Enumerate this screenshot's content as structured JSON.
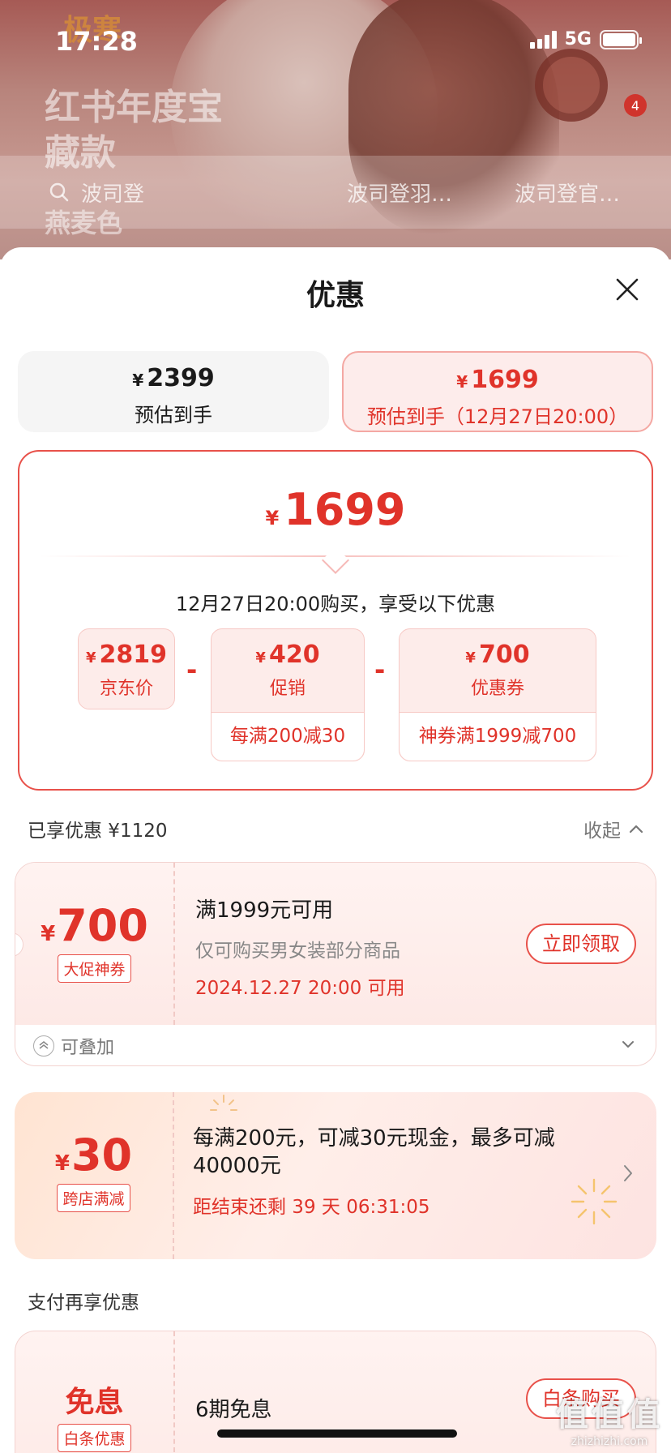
{
  "status_bar": {
    "time": "17:28",
    "network": "5G"
  },
  "background": {
    "promo_tag": "极寒",
    "promo_title": "红书年度宝藏款",
    "promo_sub": "燕麦色",
    "badge_count": "4",
    "search": [
      "波司登",
      "波司登羽…",
      "波司登官…"
    ]
  },
  "sheet": {
    "title": "优惠",
    "price_options": [
      {
        "yen": "¥",
        "price": "2399",
        "label": "预估到手"
      },
      {
        "yen": "¥",
        "price": "1699",
        "label": "预估到手（12月27日20:00）"
      }
    ],
    "calc": {
      "yen": "¥",
      "total": "1699",
      "note": "12月27日20:00购买，享受以下优惠",
      "items": [
        {
          "yen": "¥",
          "value": "2819",
          "name": "京东价",
          "extra": ""
        },
        {
          "yen": "¥",
          "value": "420",
          "name": "促销",
          "extra": "每满200减30"
        },
        {
          "yen": "¥",
          "value": "700",
          "name": "优惠券",
          "extra": "神券满1999减700"
        }
      ],
      "operator": "-"
    },
    "enjoyed": "已享优惠 ¥1120",
    "collapse": "收起",
    "coupons": [
      {
        "yen": "¥",
        "amount": "700",
        "tag": "大促神券",
        "main": "满1999元可用",
        "desc": "仅可购买男女装部分商品",
        "time": "2024.12.27 20:00 可用",
        "button": "立即领取",
        "stack": "可叠加"
      },
      {
        "yen": "¥",
        "amount": "30",
        "tag": "跨店满减",
        "main": "每满200元，可减30元现金，最多可减40000元",
        "time": "距结束还剩 39 天 06:31:05"
      }
    ],
    "pay_section": "支付再享优惠",
    "pay_coupon": {
      "amount": "免息",
      "tag": "白条优惠",
      "main": "6期免息",
      "button": "白条购买"
    }
  },
  "watermark": {
    "brand": "值值值",
    "url": "zhizhizhi.com"
  },
  "colors": {
    "accent": "#e0332a",
    "border": "#e8514a",
    "chip_bg": "#fdecea"
  }
}
